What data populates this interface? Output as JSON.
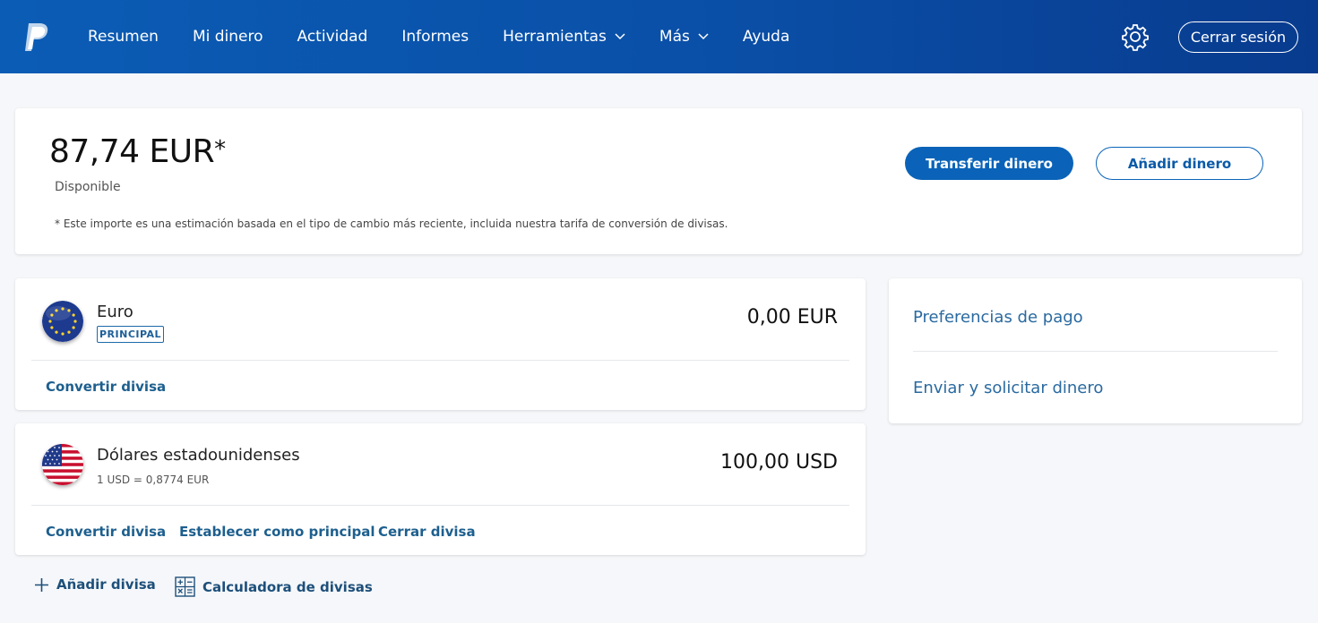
{
  "nav": {
    "items": [
      {
        "label": "Resumen",
        "has_dropdown": false
      },
      {
        "label": "Mi dinero",
        "has_dropdown": false
      },
      {
        "label": "Actividad",
        "has_dropdown": false
      },
      {
        "label": "Informes",
        "has_dropdown": false
      },
      {
        "label": "Herramientas",
        "has_dropdown": true
      },
      {
        "label": "Más",
        "has_dropdown": true
      },
      {
        "label": "Ayuda",
        "has_dropdown": false
      }
    ],
    "settings_icon": "gear-icon",
    "logout_label": "Cerrar sesión"
  },
  "balance": {
    "amount": "87,74 EUR",
    "asterisk": "*",
    "label": "Disponible",
    "note": "* Este importe es una estimación basada en el tipo de cambio más reciente, incluida nuestra tarifa de conversión de divisas.",
    "transfer_label": "Transferir dinero",
    "add_label": "Añadir dinero"
  },
  "currencies": {
    "eur": {
      "name": "Euro",
      "badge": "PRINCIPAL",
      "amount": "0,00 EUR",
      "flag_icon": "eu-flag-icon",
      "links": [
        "Convertir divisa"
      ]
    },
    "usd": {
      "name": "Dólares estadounidenses",
      "rate": "1 USD = 0,8774 EUR",
      "amount": "100,00 USD",
      "flag_icon": "us-flag-icon",
      "links": [
        "Convertir divisa",
        "Establecer como principal",
        "Cerrar divisa"
      ]
    }
  },
  "side": {
    "payment_prefs": "Preferencias de pago",
    "send_request": "Enviar y solicitar dinero"
  },
  "bottom": {
    "add_currency": "Añadir divisa",
    "calculator": "Calculadora de divisas"
  },
  "colors": {
    "header": "#0a4fa7",
    "primary_button": "#0a63b8",
    "link": "#1d5f8e",
    "background": "#f5f7fa"
  }
}
